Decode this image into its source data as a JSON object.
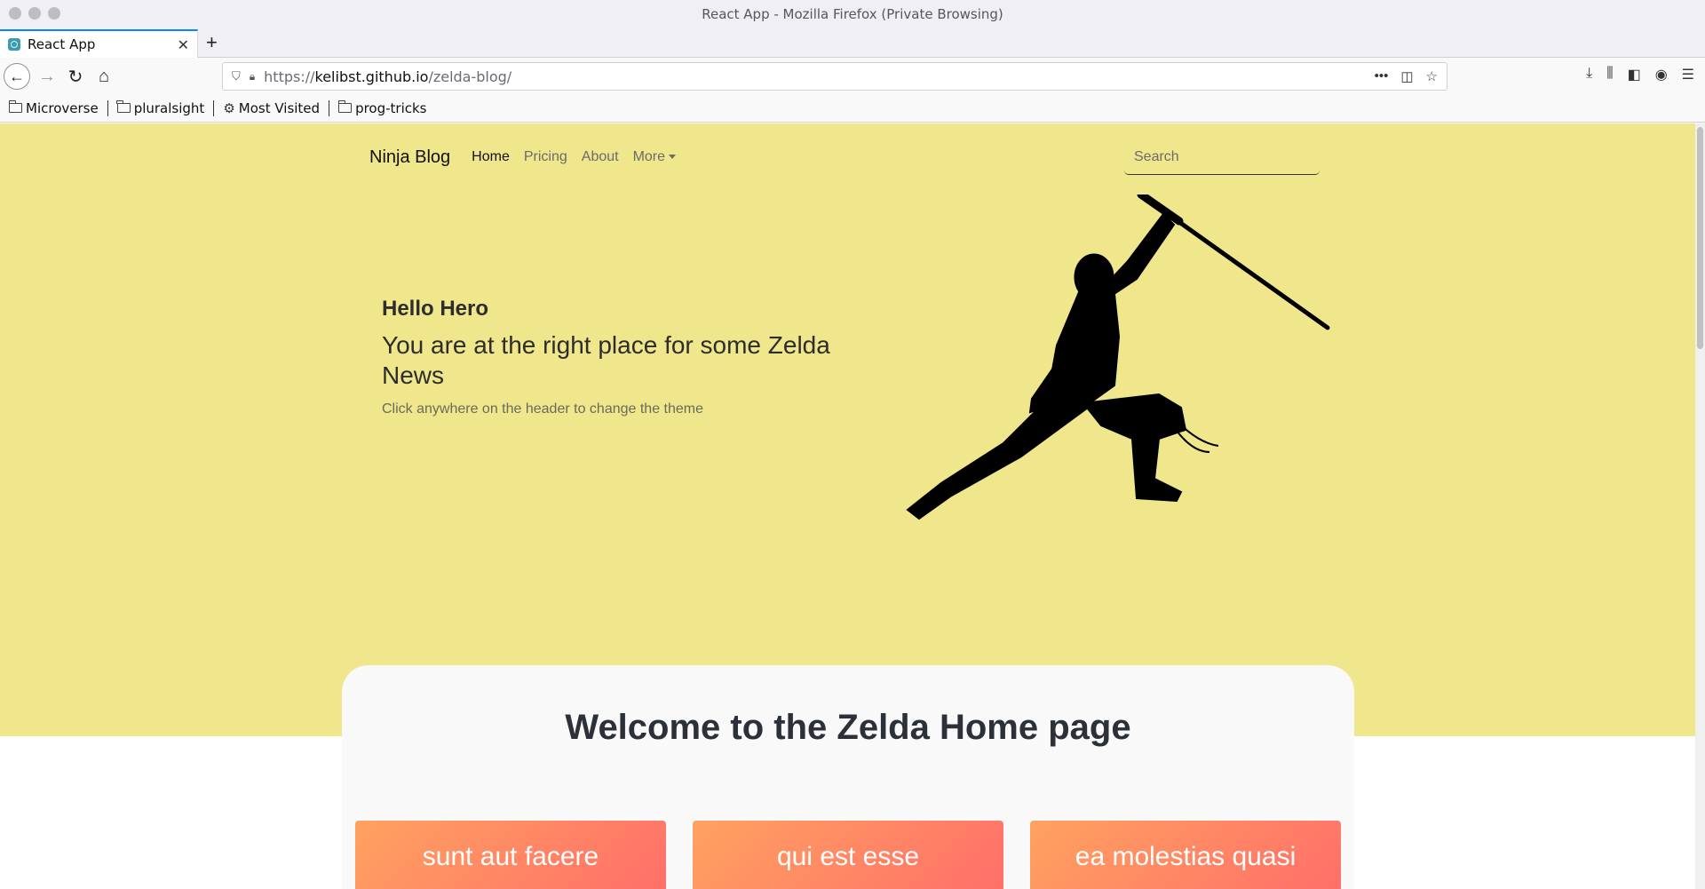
{
  "window": {
    "title": "React App - Mozilla Firefox (Private Browsing)"
  },
  "tab": {
    "title": "React App"
  },
  "address_bar": {
    "protocol": "https://",
    "host": "kelibst.github.io",
    "path": "/zelda-blog/"
  },
  "bookmarks": [
    "Microverse",
    "pluralsight",
    "Most Visited",
    "prog-tricks"
  ],
  "site_nav": {
    "brand": "Ninja Blog",
    "links": [
      "Home",
      "Pricing",
      "About",
      "More"
    ],
    "search_placeholder": "Search"
  },
  "hero": {
    "greeting": "Hello Hero",
    "subtitle": "You are at the right place for some Zelda News",
    "hint": "Click anywhere on the header to change the theme",
    "background": "#f0e68c"
  },
  "main": {
    "welcome": "Welcome to the Zelda Home page",
    "posts": [
      "sunt aut facere",
      "qui est esse",
      "ea molestias quasi"
    ]
  }
}
